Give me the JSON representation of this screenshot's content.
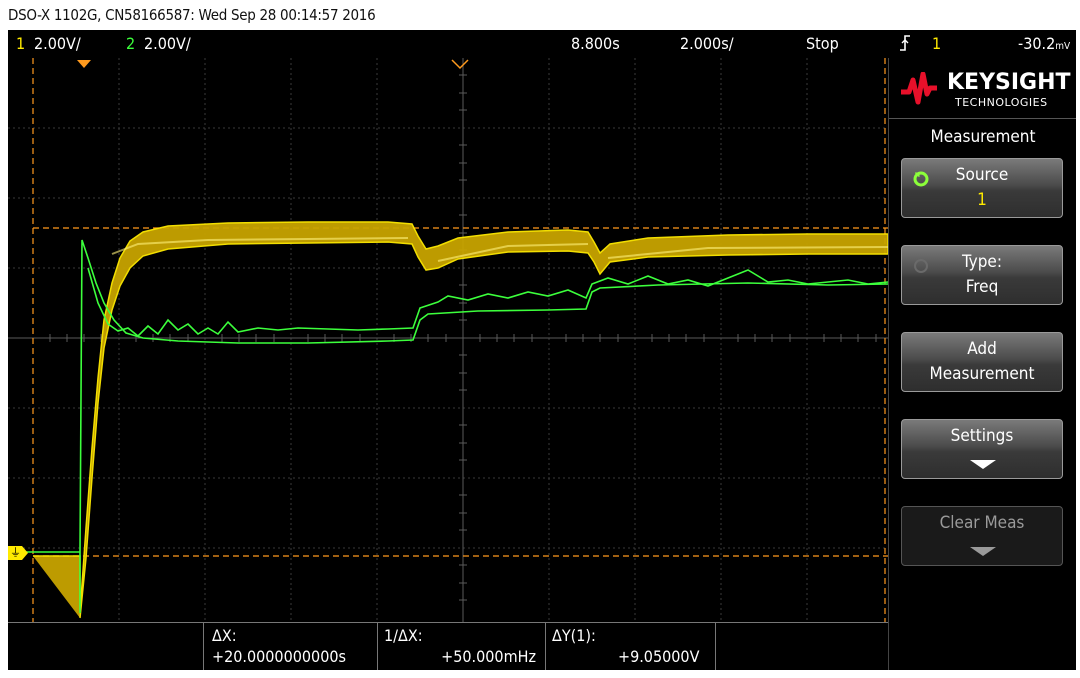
{
  "caption": "DSO-X 1102G, CN58166587: Wed Sep 28 00:14:57 2016",
  "status": {
    "ch1_num": "1",
    "ch1_scale": "2.00V/",
    "ch2_num": "2",
    "ch2_scale": "2.00V/",
    "delay": "8.800s",
    "timebase": "2.000s/",
    "run_state": "Stop",
    "trigger_edge_icon": "rising-edge-icon",
    "trigger_source": "1",
    "trigger_level": "-30.2",
    "trigger_level_unit": "mV"
  },
  "colors": {
    "ch1": "#ffea00",
    "ch2": "#3cff3c",
    "cursor": "#ff9a1e",
    "grid": "#3a3a3a"
  },
  "logo": {
    "brand": "KEYSIGHT",
    "sub": "TECHNOLOGIES"
  },
  "panel": {
    "title": "Measurement",
    "keys": [
      {
        "l1": "Source",
        "l2": "1"
      },
      {
        "l1": "Type:",
        "l2": "Freq"
      },
      {
        "l1": "Add",
        "l2": "Measurement"
      },
      {
        "l1": "Settings",
        "l2": ""
      },
      {
        "l1": "Clear Meas",
        "l2": ""
      }
    ]
  },
  "measurements": {
    "dx_label": "ΔX:",
    "dx_value": "+20.0000000000s",
    "inv_dx_label": "1/ΔX:",
    "inv_dx_value": "+50.000mHz",
    "dy_label": "ΔY(1):",
    "dy_value": "+9.05000V"
  }
}
